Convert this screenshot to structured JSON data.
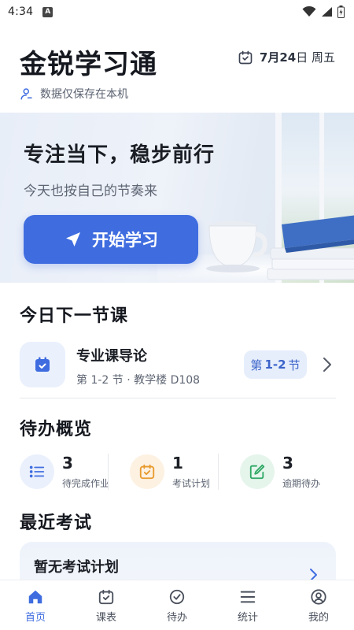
{
  "status_bar": {
    "time": "4:34",
    "app_icon_letter": "A"
  },
  "header": {
    "title": "金锐学习通",
    "date_month": "7月",
    "date_day": "24",
    "date_suffix": "日 周五",
    "local_storage_note": "数据仅保存在本机"
  },
  "hero": {
    "title": "专注当下，稳步前行",
    "subtitle": "今天也按自己的节奏来",
    "button_label": "开始学习"
  },
  "next_class": {
    "section_title": "今日下一节课",
    "course_name": "专业课导论",
    "details": "第 1-2 节 · 教学楼 D108",
    "badge_prefix": "第",
    "badge_periods": "1-2",
    "badge_suffix": "节"
  },
  "todo": {
    "section_title": "待办概览",
    "items": [
      {
        "count": "3",
        "label": "待完成作业",
        "icon": "list-icon",
        "color": "#3f6de0",
        "bg": "#eaf0fc"
      },
      {
        "count": "1",
        "label": "考试计划",
        "icon": "calendar-check-icon",
        "color": "#e89a2c",
        "bg": "#fdf1e2"
      },
      {
        "count": "3",
        "label": "逾期待办",
        "icon": "edit-square-icon",
        "color": "#2fa865",
        "bg": "#e5f5ec"
      }
    ]
  },
  "exams": {
    "section_title": "最近考试",
    "empty_text": "暂无考试计划"
  },
  "bottom_nav": {
    "items": [
      {
        "label": "首页",
        "icon": "home-icon",
        "active": true
      },
      {
        "label": "课表",
        "icon": "calendar-check-icon",
        "active": false
      },
      {
        "label": "待办",
        "icon": "check-circle-icon",
        "active": false
      },
      {
        "label": "统计",
        "icon": "menu-lines-icon",
        "active": false
      },
      {
        "label": "我的",
        "icon": "user-circle-icon",
        "active": false
      }
    ]
  },
  "colors": {
    "accent": "#3f6de0",
    "text_primary": "#15181f",
    "text_secondary": "#5e6573"
  }
}
